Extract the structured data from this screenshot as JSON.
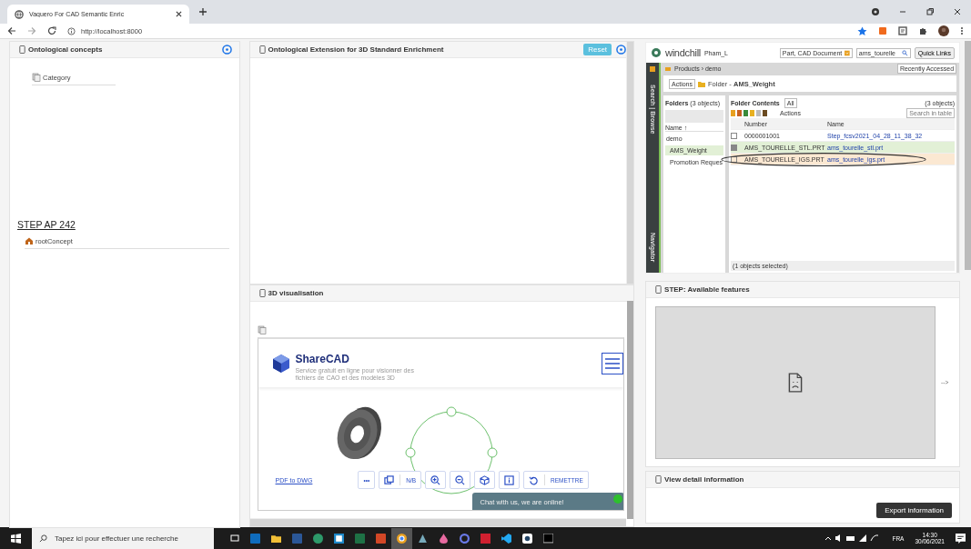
{
  "browser": {
    "tab_title": "Vaquero For CAD Semantic Enric",
    "address": "http://localhost:8000"
  },
  "concepts_panel": {
    "title": "Ontological concepts",
    "items": [
      {
        "label": "Category"
      }
    ],
    "heading": "STEP AP 242",
    "root_item": "rootConcept"
  },
  "extension_panel": {
    "title": "Ontological Extension for 3D Standard Enrichment",
    "reset_button": "Reset"
  },
  "visualisation_panel": {
    "title": "3D visualisation",
    "sharecad": {
      "brand": "ShareCAD",
      "tagline": "Service gratuit en ligne pour visionner des fichiers de CAO et des modèles 3D",
      "link": "PDF to DWG",
      "tools": [
        {
          "kind": "dots",
          "label": "•••"
        },
        {
          "kind": "layers",
          "label": "N/B"
        },
        {
          "kind": "zoom-in"
        },
        {
          "kind": "zoom-out"
        },
        {
          "kind": "cube"
        },
        {
          "kind": "info"
        },
        {
          "kind": "reset",
          "label": "REMETTRE"
        }
      ],
      "chat": "Chat with us, we are online!"
    }
  },
  "windchill": {
    "logo": "windchill",
    "user": "Pham_L",
    "type_select": "Part, CAD Document",
    "search": "ams_tourelle",
    "quick_links": "Quick Links",
    "breadcrumb": "Products › demo",
    "recent": "Recently Accessed",
    "side_tabs": [
      "Search | Browse",
      "Navigator"
    ],
    "actions": "Actions",
    "folder_title": "Folder - **AMS_Weight**",
    "folders": {
      "title": "Folders",
      "count": "(3 objects)",
      "column": "Name ↑",
      "tree": [
        {
          "label": "demo",
          "selected": false,
          "children": [
            {
              "label": "AMS_Weight",
              "selected": true
            },
            {
              "label": "Promotion Reques",
              "selected": false
            }
          ]
        }
      ]
    },
    "contents": {
      "title": "Folder Contents",
      "filter": "All",
      "count": "(3 objects)",
      "actions": "Actions",
      "search_placeholder": "Search in table",
      "columns": [
        "Number",
        "Name"
      ],
      "rows": [
        {
          "number": "0000001001",
          "name": "Step_fcsv2021_04_28_11_38_32",
          "selected": false,
          "highlighted": false
        },
        {
          "number": "AMS_TOURELLE_STL.PRT",
          "name": "ams_tourelle_stl.prt",
          "selected": true,
          "highlighted": false
        },
        {
          "number": "AMS_TOURELLE_IGS.PRT",
          "name": "ams_tourelle_igs.prt",
          "selected": false,
          "highlighted": true
        }
      ],
      "status": "(1 objects selected)"
    }
  },
  "features_panel": {
    "title": "STEP: Available features",
    "arrow_text": "-->"
  },
  "detail_panel": {
    "title": "View detail information",
    "export_button": "Export information"
  },
  "taskbar": {
    "search_placeholder": "Tapez ici pour effectuer une recherche",
    "language": "FRA",
    "time": "14:30",
    "date": "30/06/2021"
  }
}
